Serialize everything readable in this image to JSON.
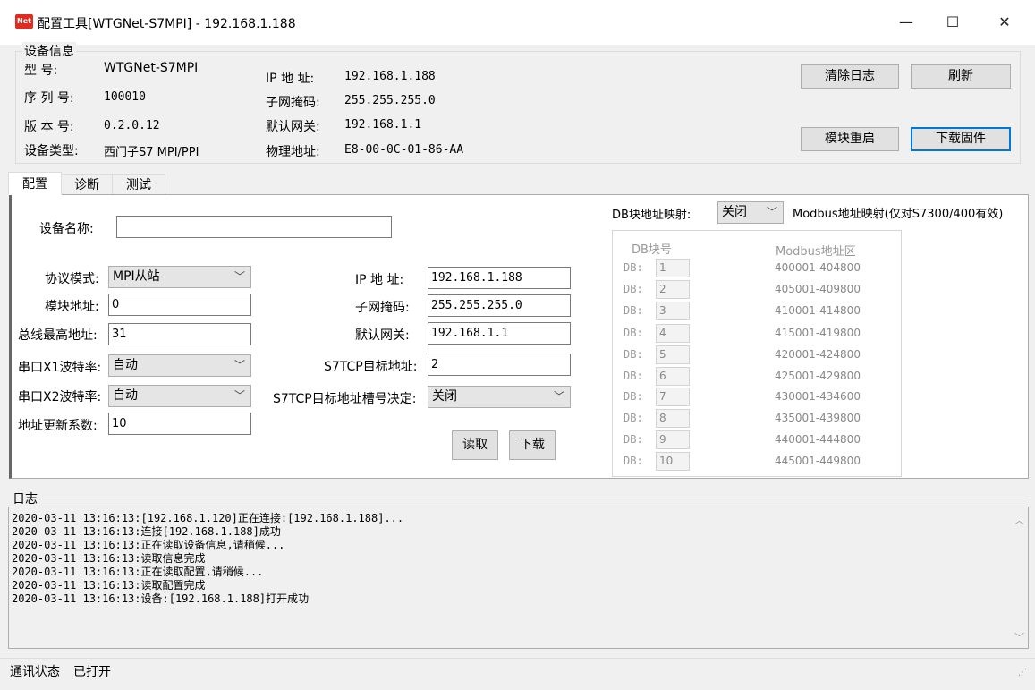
{
  "window": {
    "icon_text": "Net",
    "title": "配置工具[WTGNet-S7MPI] - 192.168.1.188",
    "minimize": "—",
    "maximize": "☐",
    "close": "✕"
  },
  "device_info": {
    "group_title": "设备信息",
    "model_label": "型    号:",
    "model_value": "WTGNet-S7MPI",
    "serial_label": "序 列 号:",
    "serial_value": "100010",
    "version_label": "版 本 号:",
    "version_value": "0.2.0.12",
    "type_label": "设备类型:",
    "type_value": "西门子S7 MPI/PPI",
    "ip_label": "IP 地 址:",
    "ip_value": "192.168.1.188",
    "mask_label": "子网掩码:",
    "mask_value": "255.255.255.0",
    "gateway_label": "默认网关:",
    "gateway_value": "192.168.1.1",
    "mac_label": "物理地址:",
    "mac_value": "E8-00-0C-01-86-AA",
    "clear_log": "清除日志",
    "refresh": "刷新",
    "reboot": "模块重启",
    "download_fw": "下载固件"
  },
  "tabs": [
    "配置",
    "诊断",
    "测试"
  ],
  "config": {
    "device_name_label": "设备名称:",
    "device_name_value": "",
    "protocol_label": "协议模式:",
    "protocol_value": "MPI从站",
    "module_addr_label": "模块地址:",
    "module_addr_value": "0",
    "bus_max_label": "总线最高地址:",
    "bus_max_value": "31",
    "x1_baud_label": "串口X1波特率:",
    "x1_baud_value": "自动",
    "x2_baud_label": "串口X2波特率:",
    "x2_baud_value": "自动",
    "update_factor_label": "地址更新系数:",
    "update_factor_value": "10",
    "ip_label": "IP 地 址:",
    "ip_value": "192.168.1.188",
    "mask_label": "子网掩码:",
    "mask_value": "255.255.255.0",
    "gateway_label": "默认网关:",
    "gateway_value": "192.168.1.1",
    "s7tcp_target_label": "S7TCP目标地址:",
    "s7tcp_target_value": "2",
    "s7tcp_slot_label": "S7TCP目标地址槽号决定:",
    "s7tcp_slot_value": "关闭",
    "read_btn": "读取",
    "download_btn": "下载",
    "db_map_label": "DB块地址映射:",
    "db_map_value": "关闭",
    "modbus_map_label": "Modbus地址映射(仅对S7300/400有效)",
    "db_col_header": "DB块号",
    "modbus_col_header": "Modbus地址区",
    "db_prefix": "DB:",
    "db_rows": [
      {
        "db": "1",
        "range": "400001-404800"
      },
      {
        "db": "2",
        "range": "405001-409800"
      },
      {
        "db": "3",
        "range": "410001-414800"
      },
      {
        "db": "4",
        "range": "415001-419800"
      },
      {
        "db": "5",
        "range": "420001-424800"
      },
      {
        "db": "6",
        "range": "425001-429800"
      },
      {
        "db": "7",
        "range": "430001-434600"
      },
      {
        "db": "8",
        "range": "435001-439800"
      },
      {
        "db": "9",
        "range": "440001-444800"
      },
      {
        "db": "10",
        "range": "445001-449800"
      }
    ]
  },
  "log": {
    "title": "日志",
    "lines": [
      "2020-03-11 13:16:13:[192.168.1.120]正在连接:[192.168.1.188]...",
      "2020-03-11 13:16:13:连接[192.168.1.188]成功",
      "2020-03-11 13:16:13:正在读取设备信息,请稍候...",
      "2020-03-11 13:16:13:读取信息完成",
      "2020-03-11 13:16:13:正在读取配置,请稍候...",
      "2020-03-11 13:16:13:读取配置完成",
      "2020-03-11 13:16:13:设备:[192.168.1.188]打开成功"
    ]
  },
  "status": {
    "label": "通讯状态",
    "value": "已打开"
  }
}
